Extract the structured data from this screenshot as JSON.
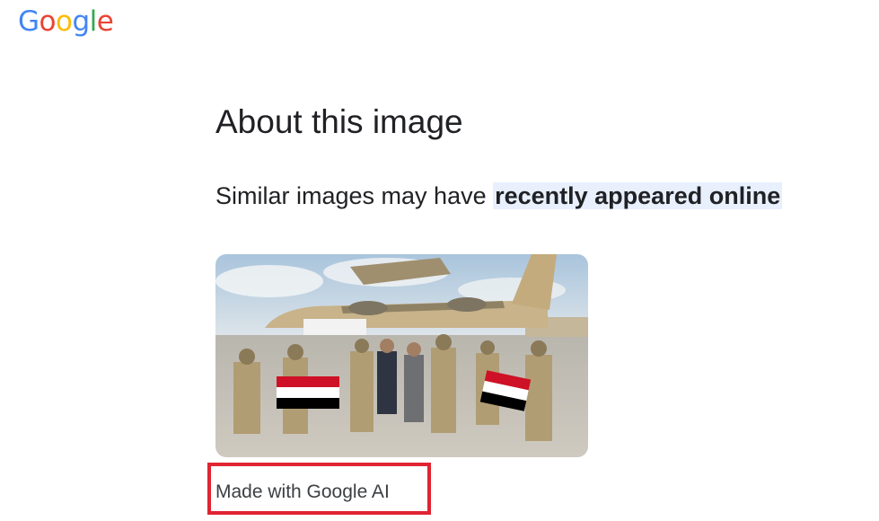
{
  "logo": {
    "letters": [
      {
        "char": "G",
        "color": "#4285F4"
      },
      {
        "char": "o",
        "color": "#EA4335"
      },
      {
        "char": "o",
        "color": "#FBBC05"
      },
      {
        "char": "g",
        "color": "#4285F4"
      },
      {
        "char": "l",
        "color": "#34A853"
      },
      {
        "char": "e",
        "color": "#EA4335"
      }
    ]
  },
  "page": {
    "title": "About this image",
    "subtitle_prefix": "Similar images may have ",
    "subtitle_highlight": "recently appeared online"
  },
  "image": {
    "description_icon": "photo-soldiers-flags-aircraft",
    "flag_colors": [
      "#CE1126",
      "#FFFFFF",
      "#000000"
    ]
  },
  "ai_label": {
    "text": "Made with Google AI",
    "highlight_color": "#e02432"
  }
}
